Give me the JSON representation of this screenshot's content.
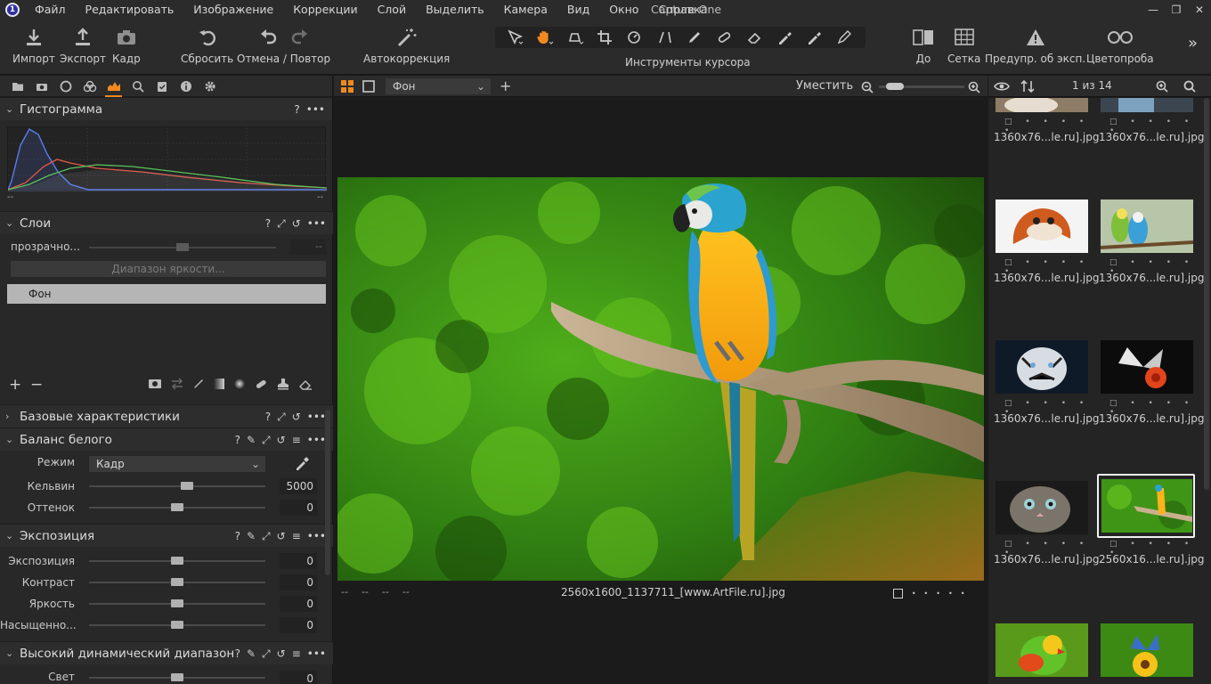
{
  "app": {
    "title": "Capture One",
    "logo_letter": "1",
    "menu": [
      "Файл",
      "Редактировать",
      "Изображение",
      "Коррекции",
      "Слой",
      "Выделить",
      "Камера",
      "Вид",
      "Окно",
      "Справка"
    ],
    "window_controls": [
      "—",
      "❐",
      "✕"
    ]
  },
  "toolbar": {
    "import_label": "Импорт",
    "export_label": "Экспорт",
    "crop_label": "Кадр",
    "reset_label": "Сбросить",
    "undo_redo_label": "Отмена / Повтор",
    "autocorrect_label": "Автокоррекция",
    "cursor_tools_label": "Инструменты курсора",
    "before_label": "До",
    "grid_label": "Сетка",
    "exposure_warning_label": "Предупр. об эксп.",
    "color_proof_label": "Цветопроба",
    "more_label": "»"
  },
  "left_panel": {
    "histogram": {
      "title": "Гистограмма",
      "left_tick": "--",
      "right_tick": "--"
    },
    "layers": {
      "title": "Слои",
      "opacity_label": "прозрачно...",
      "opacity_value": "--",
      "luma_range_label": "Диапазон яркости...",
      "background_layer": "Фон",
      "add_label": "+",
      "remove_label": "−"
    },
    "basic": {
      "title": "Базовые характеристики"
    },
    "white_balance": {
      "title": "Баланс белого",
      "mode_label": "Режим",
      "mode_value": "Кадр",
      "kelvin_label": "Кельвин",
      "kelvin_value": "5000",
      "kelvin_level": 0.56,
      "tint_label": "Оттенок",
      "tint_value": "0",
      "tint_level": 0.5
    },
    "exposure": {
      "title": "Экспозиция",
      "rows": [
        {
          "label": "Экспозиция",
          "value": "0",
          "level": 0.5
        },
        {
          "label": "Контраст",
          "value": "0",
          "level": 0.5
        },
        {
          "label": "Яркость",
          "value": "0",
          "level": 0.5
        },
        {
          "label": "Насыщенно...",
          "value": "0",
          "level": 0.5
        }
      ]
    },
    "hdr": {
      "title": "Высокий динамический диапазон",
      "first_row_label": "Свет",
      "first_row_value": "0"
    },
    "panel_help": "?",
    "panel_more": "•••"
  },
  "viewer": {
    "layer_select": "Фон",
    "zoom_label": "Уместить",
    "zoom_level": 0.1,
    "meta_placeholders": [
      "--",
      "--",
      "--",
      "--"
    ],
    "filename": "2560x1600_1137711_[www.ArtFile.ru].jpg"
  },
  "browser": {
    "count": "1 из 14",
    "thumbnails": [
      {
        "name": "1360x76...le.ru].jpg",
        "subject": "partial-top"
      },
      {
        "name": "1360x76...le.ru].jpg",
        "subject": "partial-top"
      },
      {
        "name": "1360x76...le.ru].jpg",
        "subject": "fox"
      },
      {
        "name": "1360x76...le.ru].jpg",
        "subject": "budgies"
      },
      {
        "name": "1360x76...le.ru].jpg",
        "subject": "tiger"
      },
      {
        "name": "1360x76...le.ru].jpg",
        "subject": "butterfly-flower"
      },
      {
        "name": "1360x76...le.ru].jpg",
        "subject": "kitten"
      },
      {
        "name": "2560x16...le.ru].jpg",
        "subject": "parrot-selected"
      },
      {
        "name": "",
        "subject": "lovebird"
      },
      {
        "name": "",
        "subject": "butterfly-yellow"
      }
    ],
    "meta_dots": "□ • • • • •"
  },
  "colors": {
    "accent": "#f08a20",
    "panel_bg": "#282828",
    "selected_layer_bg": "#b5b5b5"
  }
}
